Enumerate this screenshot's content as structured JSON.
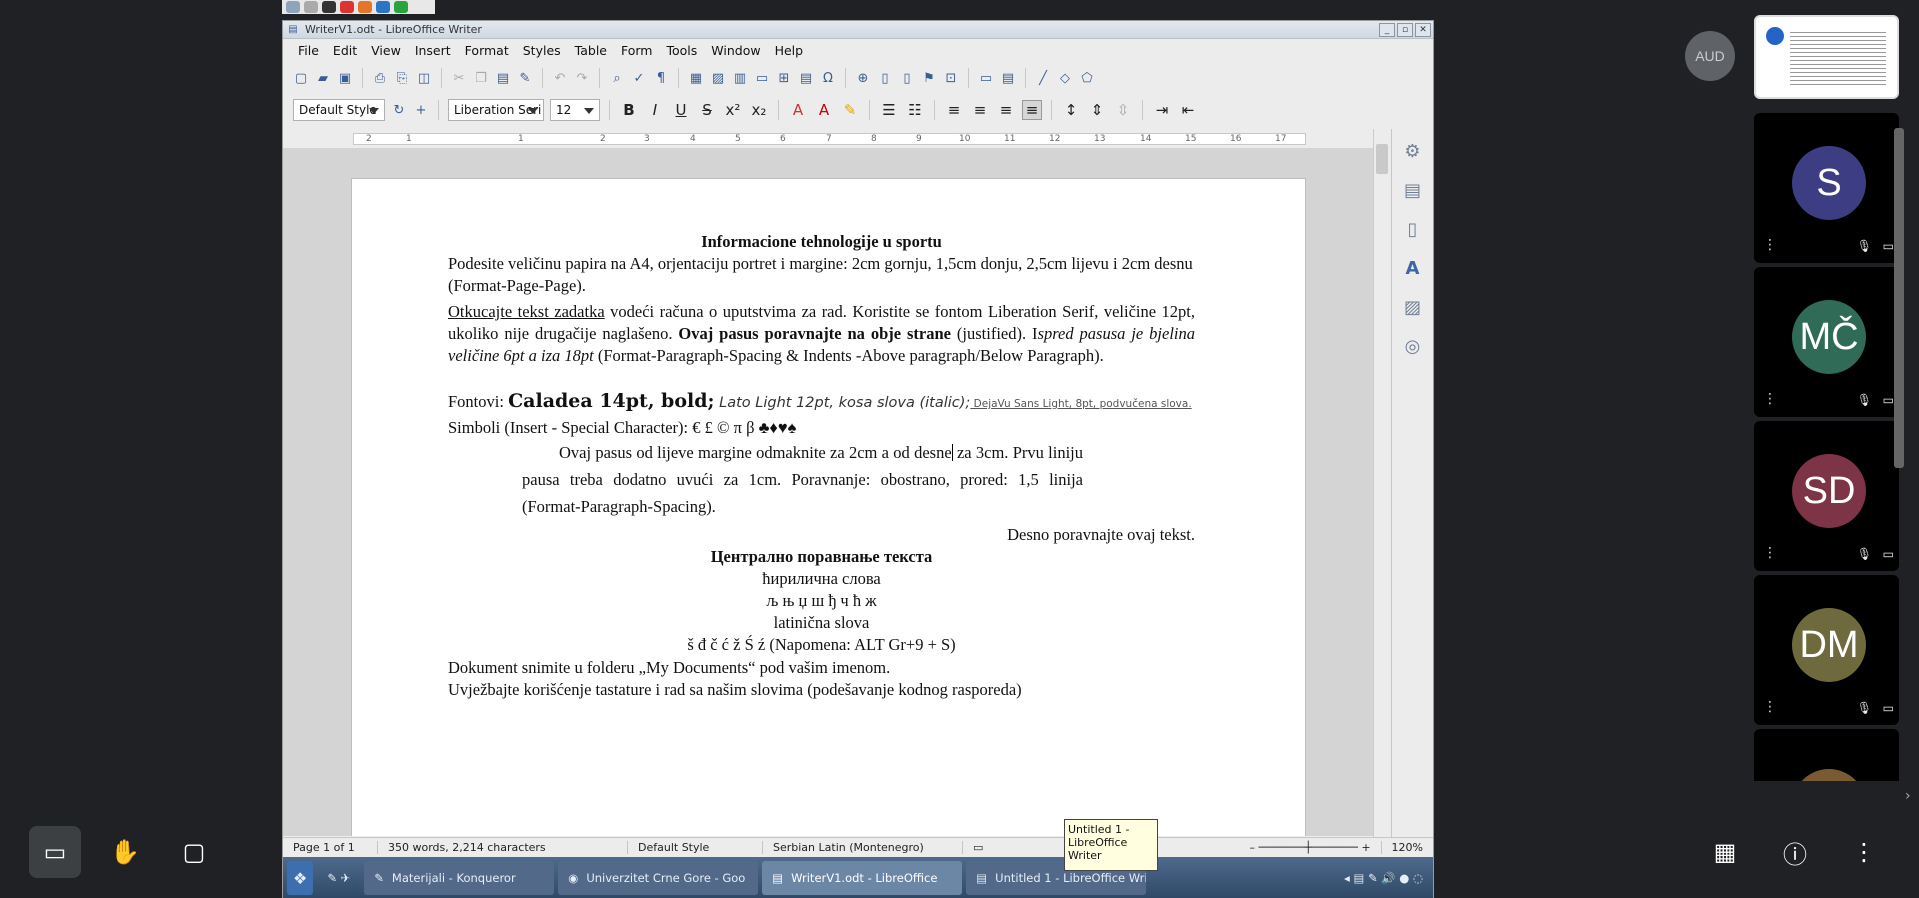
{
  "meeting": {
    "audio_badge": "AUD",
    "participants": [
      {
        "initials": "S",
        "color": "#3d3d84"
      },
      {
        "initials": "MČ",
        "color": "#2f6b56"
      },
      {
        "initials": "SD",
        "color": "#7d3446"
      },
      {
        "initials": "DM",
        "color": "#6e6a3d"
      }
    ]
  },
  "window": {
    "title": "WriterV1.odt - LibreOffice Writer",
    "menus": [
      "File",
      "Edit",
      "View",
      "Insert",
      "Format",
      "Styles",
      "Table",
      "Form",
      "Tools",
      "Window",
      "Help"
    ]
  },
  "toolbar": {
    "paragraph_style": "Default Style",
    "font_name": "Liberation Seri",
    "font_size": "12"
  },
  "document": {
    "title": "Informacione tehnologije u sportu",
    "p1": "Podesite veličinu papira na A4, orjentaciju portret i margine: 2cm gornju, 1,5cm donju, 2,5cm lijevu i 2cm desnu (Format-Page-Page).",
    "p2_underline": "Otkucajte tekst zadatka",
    "p2_a": " vodeći računa o uputstvima za rad. Koristite se fontom Liberation Serif, veličine 12pt, ukoliko nije drugačije naglašeno. ",
    "p2_bold": "Ovaj pasus poravnajte na obje strane",
    "p2_b": " (justified). I",
    "p2_italic": "spred pasusa je bjelina veličine 6pt a iza 18pt",
    "p2_c": " (Format-Paragraph-Spacing & Indents -Above paragraph/Below Paragraph).",
    "fonts_label": "Fontovi: ",
    "fonts_bold": "Caladea 14pt, bold;",
    "fonts_italic": " Lato Light 12pt, kosa slova (italic);",
    "fonts_small": " DejaVu Sans Light, 8pt, podvučena slova.",
    "symbols": "Simboli (Insert - Special Character): € £ © π β ♣♦♥♠",
    "indent1": "Ovaj pasus od lijeve margine odmaknite za 2cm a od desne",
    "indent2": "za 3cm. Prvu liniju pausa treba dodatno uvući za 1cm. Poravnanje:",
    "indent3": "obostrano, prored: 1,5 linija (Format-Paragraph-Spacing).",
    "right_line": "Desno poravnajte ovaj tekst.",
    "cyr_title": "Централно поравнање текста",
    "cyr_sub": "ћирилична слова",
    "cyr_letters": "љ њ џ ш ђ ч ћ ж",
    "lat_sub": "latinična slova",
    "lat_letters": "š đ č ć ž Ś ź (Napomena: ALT Gr+9 + S)",
    "save_line": "Dokument snimite u folderu „My Documents“ pod vašim imenom.",
    "practice_line": "Uvježbajte korišćenje tastature i rad sa našim slovima (podešavanje kodnog rasporeda)"
  },
  "status": {
    "page": "Page 1 of 1",
    "words": "350 words, 2,214 characters",
    "style": "Default Style",
    "language": "Serbian Latin (Montenegro)",
    "zoom": "120%"
  },
  "taskbar": {
    "tasks": [
      "Materijali - Konqueror",
      "Univerzitet Crne Gore - Goo",
      "WriterV1.odt - LibreOffice",
      "Untitled 1 - LibreOffice Writ"
    ],
    "tooltip": "Untitled 1 - LibreOffice Writer"
  }
}
